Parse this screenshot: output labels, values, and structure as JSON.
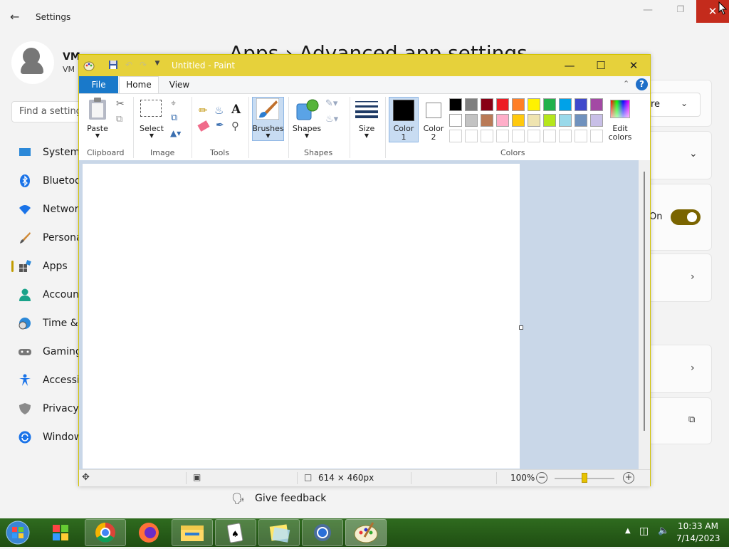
{
  "settings": {
    "title": "Settings",
    "user_name": "VM",
    "user_sub": "VM",
    "search_placeholder": "Find a setting",
    "heading": "Apps  ›  Advanced app settings",
    "nav": [
      {
        "label": "System",
        "icon": "monitor-icon"
      },
      {
        "label": "Bluetooth & devices",
        "icon": "bluetooth-icon"
      },
      {
        "label": "Network & internet",
        "icon": "wifi-icon"
      },
      {
        "label": "Personalization",
        "icon": "brush-icon"
      },
      {
        "label": "Apps",
        "icon": "apps-icon"
      },
      {
        "label": "Accounts",
        "icon": "account-icon"
      },
      {
        "label": "Time & language",
        "icon": "clock-globe-icon"
      },
      {
        "label": "Gaming",
        "icon": "gamepad-icon"
      },
      {
        "label": "Accessibility",
        "icon": "accessibility-icon"
      },
      {
        "label": "Privacy & security",
        "icon": "shield-icon"
      },
      {
        "label": "Windows Update",
        "icon": "update-icon"
      }
    ],
    "dropdown_value": "re",
    "toggle_label": "On",
    "feedback": "Give feedback"
  },
  "paint": {
    "title": "Untitled - Paint",
    "tabs": {
      "file": "File",
      "home": "Home",
      "view": "View"
    },
    "groups": {
      "clipboard": "Clipboard",
      "image": "Image",
      "tools": "Tools",
      "shapes": "Shapes",
      "colors": "Colors"
    },
    "buttons": {
      "paste": "Paste",
      "select": "Select",
      "brushes": "Brushes",
      "shapes": "Shapes",
      "size": "Size",
      "color1_a": "Color",
      "color1_b": "1",
      "color2_a": "Color",
      "color2_b": "2",
      "edit_a": "Edit",
      "edit_b": "colors"
    },
    "palette_row1": [
      "#000000",
      "#7f7f7f",
      "#880015",
      "#ed1c24",
      "#ff7f27",
      "#fff200",
      "#22b14c",
      "#00a2e8",
      "#3f48cc",
      "#a349a4"
    ],
    "palette_row2": [
      "#ffffff",
      "#c3c3c3",
      "#b97a57",
      "#ffaec9",
      "#ffc90e",
      "#efe4b0",
      "#b5e61d",
      "#99d9ea",
      "#7092be",
      "#c8bfe7"
    ],
    "color1": "#000000",
    "color2": "#ffffff",
    "canvas_size": "614 × 460px",
    "zoom": "100%"
  },
  "taskbar": {
    "time": "10:33 AM",
    "date": "7/14/2023"
  }
}
